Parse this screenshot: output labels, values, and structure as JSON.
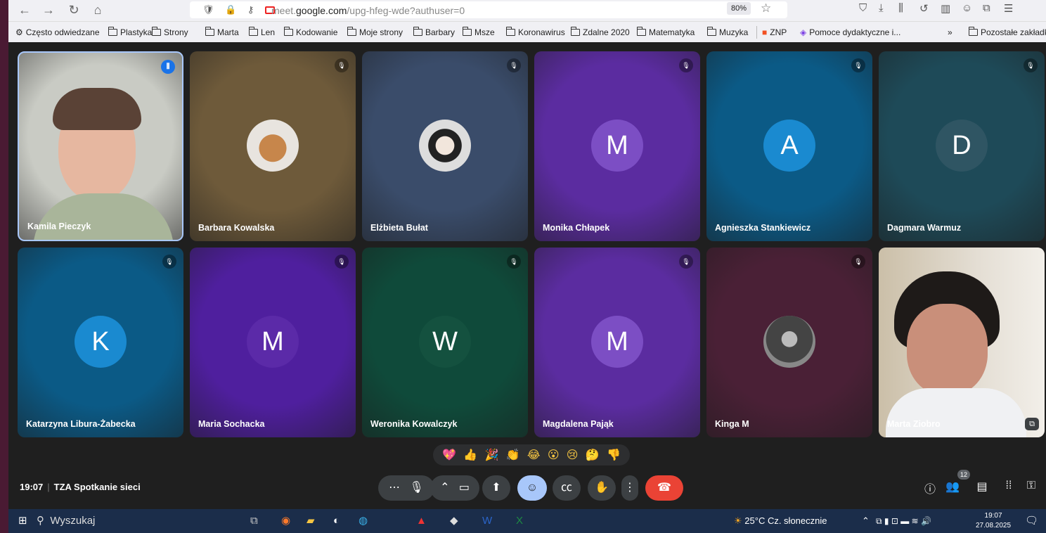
{
  "browser": {
    "url_prefix": "meet.",
    "url_domain": "google.com",
    "url_path": "/upg-hfeg-wde?authuser=0",
    "zoom": "80%"
  },
  "bookmarks": [
    {
      "label": "Często odwiedzane",
      "icon": "gear-icon"
    },
    {
      "label": "Plastyka",
      "icon": "folder-icon"
    },
    {
      "label": "Strony",
      "icon": "folder-icon"
    },
    {
      "label": "Marta",
      "icon": "folder-icon"
    },
    {
      "label": "Len",
      "icon": "folder-icon"
    },
    {
      "label": "Kodowanie",
      "icon": "folder-icon"
    },
    {
      "label": "Moje strony",
      "icon": "folder-icon"
    },
    {
      "label": "Barbary",
      "icon": "folder-icon"
    },
    {
      "label": "Msze",
      "icon": "folder-icon"
    },
    {
      "label": "Koronawirus",
      "icon": "folder-icon"
    },
    {
      "label": "Zdalne 2020",
      "icon": "folder-icon"
    },
    {
      "label": "Matematyka",
      "icon": "folder-icon"
    },
    {
      "label": "Muzyka",
      "icon": "folder-icon"
    },
    {
      "label": "ZNP",
      "icon": "windows-icon"
    },
    {
      "label": "Pomoce dydaktyczne i...",
      "icon": "link-icon"
    }
  ],
  "bookmarks_other": "Pozostałe zakładki",
  "participants": [
    {
      "name": "Kamila Pieczyk",
      "initial": "",
      "type": "video",
      "bg": "#c9cbc4",
      "status": "speaking"
    },
    {
      "name": "Barbara Kowalska",
      "initial": "",
      "type": "photo",
      "bg": "#6e5a3a",
      "status": "muted"
    },
    {
      "name": "Elżbieta Bułat",
      "initial": "",
      "type": "photo",
      "bg": "#3a4c6a",
      "status": "muted"
    },
    {
      "name": "Monika Chłapek",
      "initial": "M",
      "type": "letter",
      "bg": "#5b2ca0",
      "avatar_bg": "#7c4ec4",
      "status": "muted"
    },
    {
      "name": "Agnieszka Stankiewicz",
      "initial": "A",
      "type": "letter",
      "bg": "#0b5a86",
      "avatar_bg": "#1a8ad0",
      "status": "muted"
    },
    {
      "name": "Dagmara Warmuz",
      "initial": "D",
      "type": "letter",
      "bg": "#1e4a58",
      "avatar_bg": "#2f5563",
      "status": "muted"
    },
    {
      "name": "Katarzyna Libura-Żabecka",
      "initial": "K",
      "type": "letter",
      "bg": "#0b5a86",
      "avatar_bg": "#1a8ad0",
      "status": "muted"
    },
    {
      "name": "Maria Sochacka",
      "initial": "M",
      "type": "letter",
      "bg": "#4f1f9e",
      "avatar_bg": "#5b2aa8",
      "status": "muted"
    },
    {
      "name": "Weronika Kowalczyk",
      "initial": "W",
      "type": "letter",
      "bg": "#0f4a3a",
      "avatar_bg": "#14513f",
      "status": "muted"
    },
    {
      "name": "Magdalena Pająk",
      "initial": "M",
      "type": "letter",
      "bg": "#5b2ca0",
      "avatar_bg": "#7c4ec4",
      "status": "muted"
    },
    {
      "name": "Kinga M",
      "initial": "",
      "type": "photo",
      "bg": "#4a2036",
      "status": "muted"
    },
    {
      "name": "Marta Ziobro",
      "initial": "",
      "type": "video",
      "bg": "#d8d4cc",
      "status": "pip"
    }
  ],
  "reactions": [
    "💖",
    "👍",
    "🎉",
    "👏",
    "😂",
    "😮",
    "😢",
    "🤔",
    "👎"
  ],
  "meeting": {
    "time": "19:07",
    "name": "TZA Spotkanie sieci"
  },
  "participant_count": "12",
  "taskbar": {
    "search_placeholder": "Wyszukaj",
    "weather": "25°C  Cz. słonecznie",
    "clock_time": "19:07",
    "clock_date": "27.08.2025"
  }
}
